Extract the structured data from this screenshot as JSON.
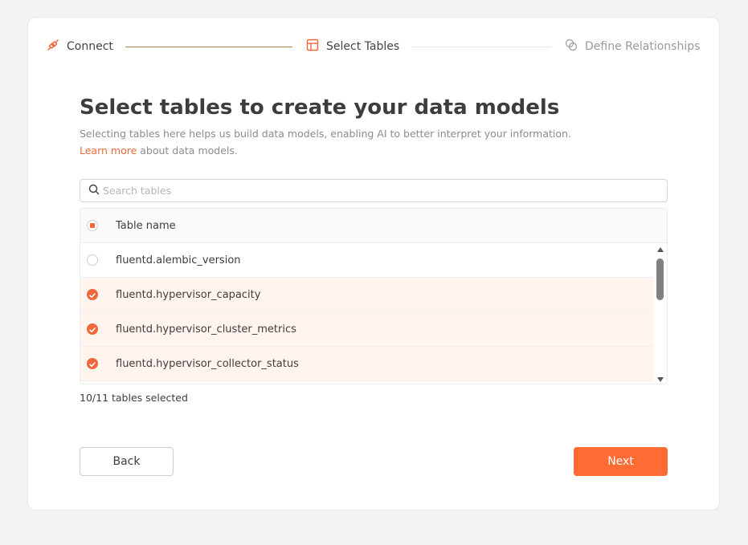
{
  "stepper": {
    "steps": [
      {
        "label": "Connect",
        "icon": "plug-icon",
        "state": "done"
      },
      {
        "label": "Select Tables",
        "icon": "table-icon",
        "state": "active"
      },
      {
        "label": "Define Relationships",
        "icon": "relationship-icon",
        "state": "pending"
      }
    ]
  },
  "heading": {
    "title": "Select tables to create your data models",
    "description": "Selecting tables here helps us build data models, enabling AI to better interpret your information.",
    "learn_more": "Learn more",
    "learn_more_suffix": " about data models."
  },
  "search": {
    "placeholder": "Search tables",
    "value": ""
  },
  "table": {
    "header": "Table name",
    "rows": [
      {
        "name": "fluentd.alembic_version",
        "selected": false
      },
      {
        "name": "fluentd.hypervisor_capacity",
        "selected": true
      },
      {
        "name": "fluentd.hypervisor_cluster_metrics",
        "selected": true
      },
      {
        "name": "fluentd.hypervisor_collector_status",
        "selected": true
      }
    ]
  },
  "selection_count": "10/11 tables selected",
  "buttons": {
    "back": "Back",
    "next": "Next"
  },
  "colors": {
    "accent": "#ff6b35",
    "selected_row_bg": "#fff5ee"
  }
}
